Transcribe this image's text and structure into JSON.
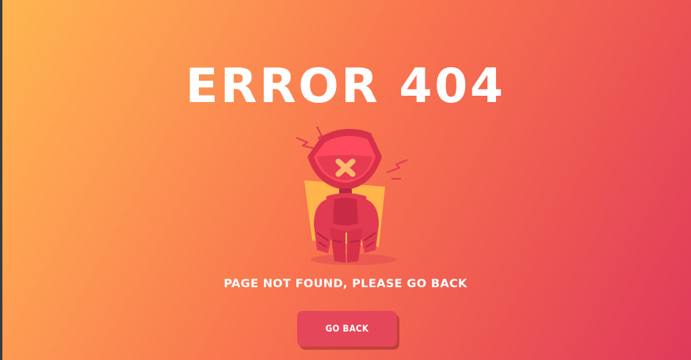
{
  "title": "ERROR 404",
  "message": "PAGE NOT FOUND, PLEASE GO BACK",
  "button_label": "GO BACK",
  "colors": {
    "gradient_start": "#ffb650",
    "gradient_end": "#e03a5b",
    "button": "#e5465a",
    "robot": "#e23a52",
    "robot_visor": "#ff4a5d",
    "robot_x": "#ffb86b",
    "backdrop": "#ffb44c"
  },
  "illustration": {
    "icon": "broken-robot-icon"
  }
}
